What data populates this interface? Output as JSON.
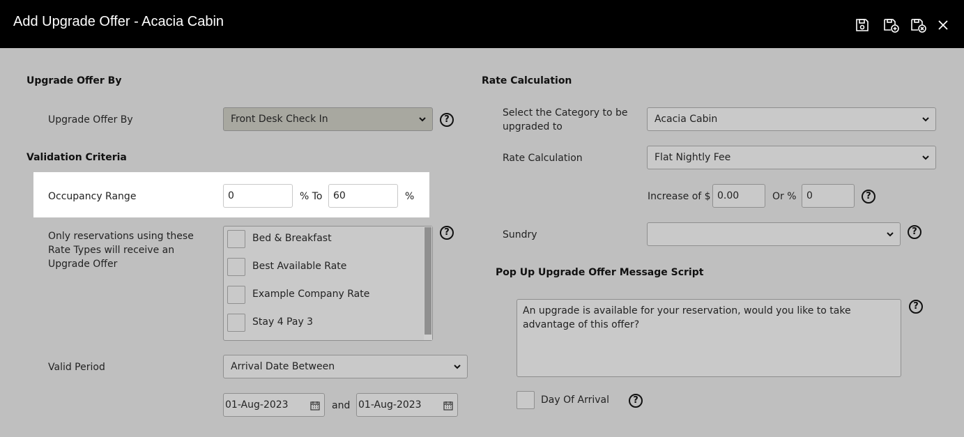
{
  "window": {
    "title": "Add Upgrade Offer - Acacia Cabin"
  },
  "toolbar": {
    "icons": [
      "save-icon",
      "save-and-add-icon",
      "save-and-close-icon",
      "close-icon"
    ]
  },
  "left": {
    "section_upgrade": "Upgrade Offer By",
    "upgrade_label": "Upgrade Offer By",
    "upgrade_value": "Front Desk Check In",
    "section_validation": "Validation Criteria",
    "occupancy_label": "Occupancy Range",
    "occupancy_from": "0",
    "occupancy_to_label": "% To",
    "occupancy_to": "60",
    "occupancy_pct": "%",
    "rate_types_label": "Only reservations using these Rate Types will receive an Upgrade Offer",
    "rate_types": [
      {
        "label": "Bed & Breakfast",
        "checked": false
      },
      {
        "label": "Best Available Rate",
        "checked": false
      },
      {
        "label": "Example Company Rate",
        "checked": false
      },
      {
        "label": "Stay 4 Pay 3",
        "checked": false
      }
    ],
    "valid_period_label": "Valid Period",
    "valid_period_value": "Arrival Date Between",
    "date_from": "01-Aug-2023",
    "and_label": "and",
    "date_to": "01-Aug-2023"
  },
  "right": {
    "section_rate": "Rate Calculation",
    "category_label": "Select the Category to be upgraded to",
    "category_value": "Acacia Cabin",
    "rate_calc_label": "Rate Calculation",
    "rate_calc_value": "Flat Nightly Fee",
    "increase_label": "Increase of $",
    "increase_value": "0.00",
    "or_pct_label": "Or %",
    "or_pct_value": "0",
    "sundry_label": "Sundry",
    "sundry_value": "",
    "section_popup": "Pop Up Upgrade Offer Message Script",
    "message": "An upgrade is available for your reservation, would you like to take advantage of this offer?",
    "day_of_arrival_label": "Day Of Arrival",
    "day_of_arrival_checked": false
  },
  "help_symbol": "?"
}
